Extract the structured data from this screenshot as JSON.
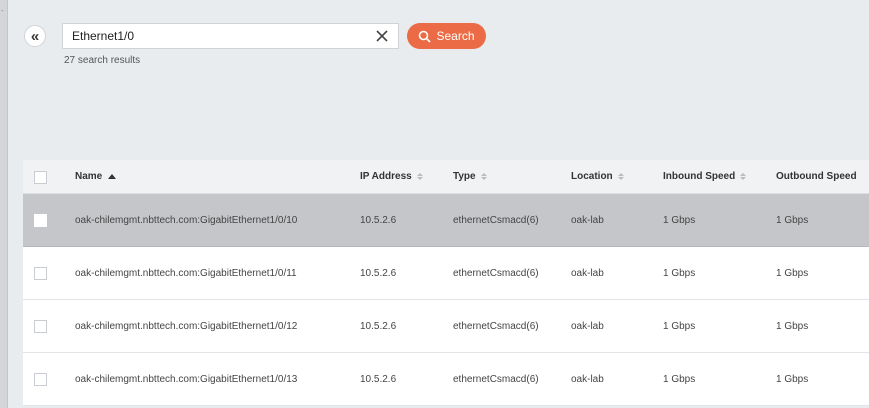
{
  "search": {
    "value": "Ethernet1/0",
    "button_label": "Search",
    "results_text": "27 search results"
  },
  "colors": {
    "accent": "#ea6b45",
    "selected_row": "#c4c6c9",
    "background": "#e9ecef"
  },
  "table": {
    "columns": [
      {
        "label": "Name",
        "sort": "asc"
      },
      {
        "label": "IP Address",
        "sort": "none"
      },
      {
        "label": "Type",
        "sort": "none"
      },
      {
        "label": "Location",
        "sort": "none"
      },
      {
        "label": "Inbound Speed",
        "sort": "none"
      },
      {
        "label": "Outbound Speed",
        "sort": "none"
      }
    ],
    "rows": [
      {
        "name": "oak-chilemgmt.nbttech.com:GigabitEthernet1/0/10",
        "ip": "10.5.2.6",
        "type": "ethernetCsmacd(6)",
        "location": "oak-lab",
        "inbound": "1 Gbps",
        "outbound": "1 Gbps",
        "selected": true
      },
      {
        "name": "oak-chilemgmt.nbttech.com:GigabitEthernet1/0/11",
        "ip": "10.5.2.6",
        "type": "ethernetCsmacd(6)",
        "location": "oak-lab",
        "inbound": "1 Gbps",
        "outbound": "1 Gbps",
        "selected": false
      },
      {
        "name": "oak-chilemgmt.nbttech.com:GigabitEthernet1/0/12",
        "ip": "10.5.2.6",
        "type": "ethernetCsmacd(6)",
        "location": "oak-lab",
        "inbound": "1 Gbps",
        "outbound": "1 Gbps",
        "selected": false
      },
      {
        "name": "oak-chilemgmt.nbttech.com:GigabitEthernet1/0/13",
        "ip": "10.5.2.6",
        "type": "ethernetCsmacd(6)",
        "location": "oak-lab",
        "inbound": "1 Gbps",
        "outbound": "1 Gbps",
        "selected": false
      }
    ]
  }
}
